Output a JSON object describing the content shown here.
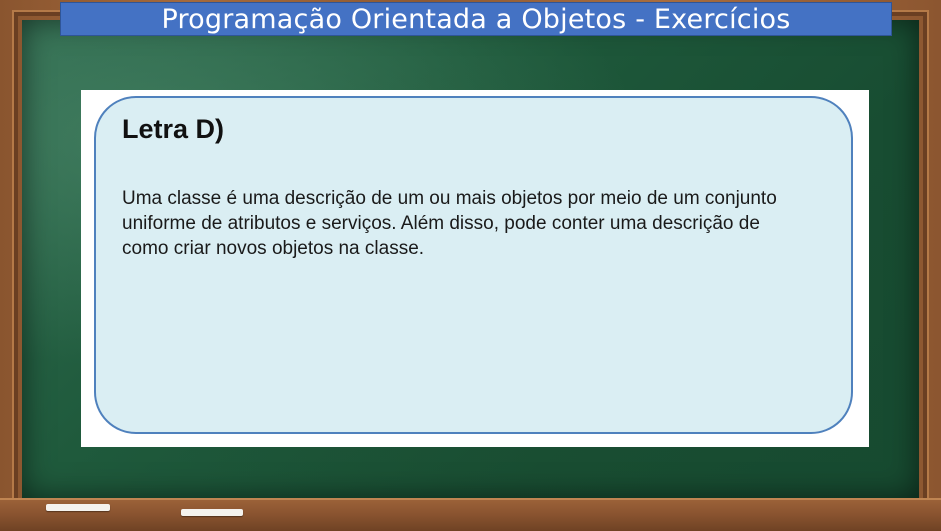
{
  "slide": {
    "title": "Programação Orientada a Objetos - Exercícios"
  },
  "card": {
    "heading": "Letra D)",
    "body_lines": [
      "Uma classe é uma descrição de um ou mais objetos por meio de um conjunto",
      "uniforme de atributos e serviços. Além disso, pode conter uma descrição de",
      "como criar novos objetos na classe."
    ]
  },
  "colors": {
    "title_bar": "#4472c4",
    "card_fill": "#daeef3",
    "card_border": "#4f81bd",
    "chalkboard": "#1f5a3c",
    "frame": "#8a552f"
  }
}
